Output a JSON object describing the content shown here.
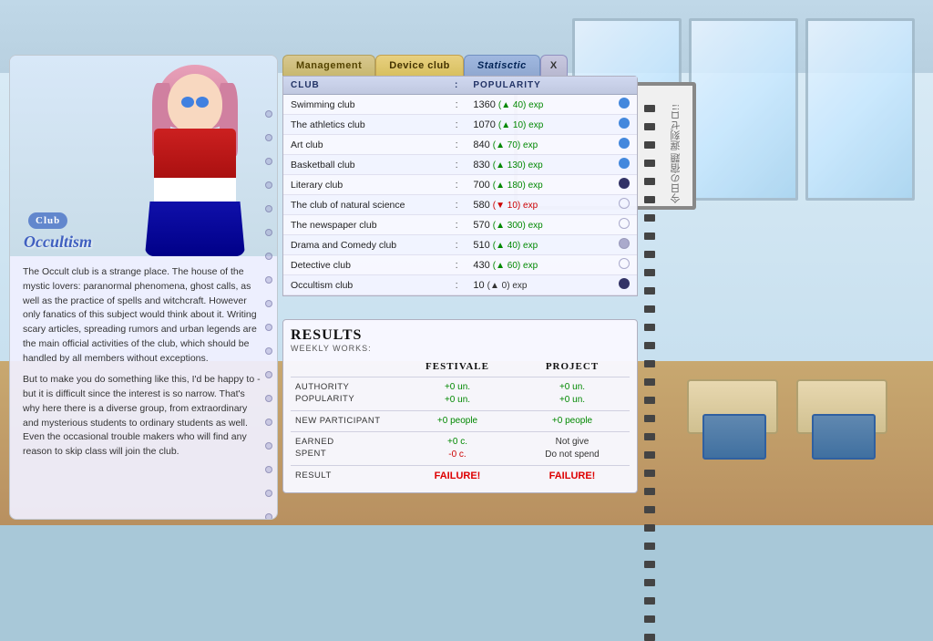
{
  "background": {
    "ceiling_color": "#b8d8e8",
    "wall_color": "#d8eaf5",
    "floor_color": "#c8a870"
  },
  "tabs": {
    "management": "Management",
    "device_club": "Device club",
    "statistic": "Statisctic",
    "close": "X"
  },
  "table": {
    "headers": {
      "club": "Club",
      "separator": ":",
      "popularity": "Popularity"
    },
    "rows": [
      {
        "name": "Swimming club",
        "popularity": "1360",
        "change": "+40",
        "change_type": "green",
        "indicator": "blue"
      },
      {
        "name": "The athletics club",
        "popularity": "1070",
        "change": "+10",
        "change_type": "green",
        "indicator": "blue"
      },
      {
        "name": "Art club",
        "popularity": "840",
        "change": "+70",
        "change_type": "green",
        "indicator": "blue"
      },
      {
        "name": "Basketball club",
        "popularity": "830",
        "change": "+130",
        "change_type": "green",
        "indicator": "blue"
      },
      {
        "name": "Literary club",
        "popularity": "700",
        "change": "+180",
        "change_type": "green",
        "indicator": "dark"
      },
      {
        "name": "The club of natural science",
        "popularity": "580",
        "change": "-10",
        "change_type": "red",
        "indicator": "empty"
      },
      {
        "name": "The newspaper club",
        "popularity": "570",
        "change": "+300",
        "change_type": "green",
        "indicator": "empty"
      },
      {
        "name": "Drama and Comedy club",
        "popularity": "510",
        "change": "+40",
        "change_type": "green",
        "indicator": "gray"
      },
      {
        "name": "Detective club",
        "popularity": "430",
        "change": "+60",
        "change_type": "green",
        "indicator": "empty"
      },
      {
        "name": "Occultism club",
        "popularity": "10",
        "change": "0",
        "change_type": "normal",
        "indicator": "dark"
      }
    ]
  },
  "results": {
    "title": "Results",
    "weekly_label": "Weekly works:",
    "col_festivale": "Festivale",
    "col_project": "Project",
    "rows": [
      {
        "label": "Authority\nPopularity",
        "festivale_val": "+0 un.\n+0 un.",
        "project_val": "+0 un.\n+0 un.",
        "festivale_color": "green",
        "project_color": "green"
      },
      {
        "label": "New participant",
        "festivale_val": "+0 people",
        "project_val": "+0 people",
        "festivale_color": "green",
        "project_color": "green"
      },
      {
        "label": "Earned\nSpent",
        "festivale_val": "+0 c.\n-0 c.",
        "project_val": "Not give\nDo not spend",
        "festivale_color": "green",
        "project_color": "normal"
      },
      {
        "label": "Result",
        "festivale_val": "FAILURE!",
        "project_val": "FAILURE!",
        "festivale_color": "red",
        "project_color": "red"
      }
    ]
  },
  "character": {
    "club_badge": "Club",
    "club_name": "Occultism",
    "description_1": "The Occult club is a strange place. The house of the mystic lovers: paranormal phenomena, ghost calls, as well as the practice of spells and witchcraft. However only fanatics of this subject would think about it. Writing scary articles, spreading rumors and urban legends are the main official activities of the club, which should be handled by all members without exceptions.",
    "description_2": "But to make you do something like this, I'd be happy to - but it is difficult since the interest is so narrow. That's why here there is a diverse group, from extraordinary and mysterious students to ordinary students as well. Even the occasional trouble makers who will find any reason to skip class will join the club."
  },
  "whiteboard_text": "今日の宿題\n遅刻ゼロ!!"
}
